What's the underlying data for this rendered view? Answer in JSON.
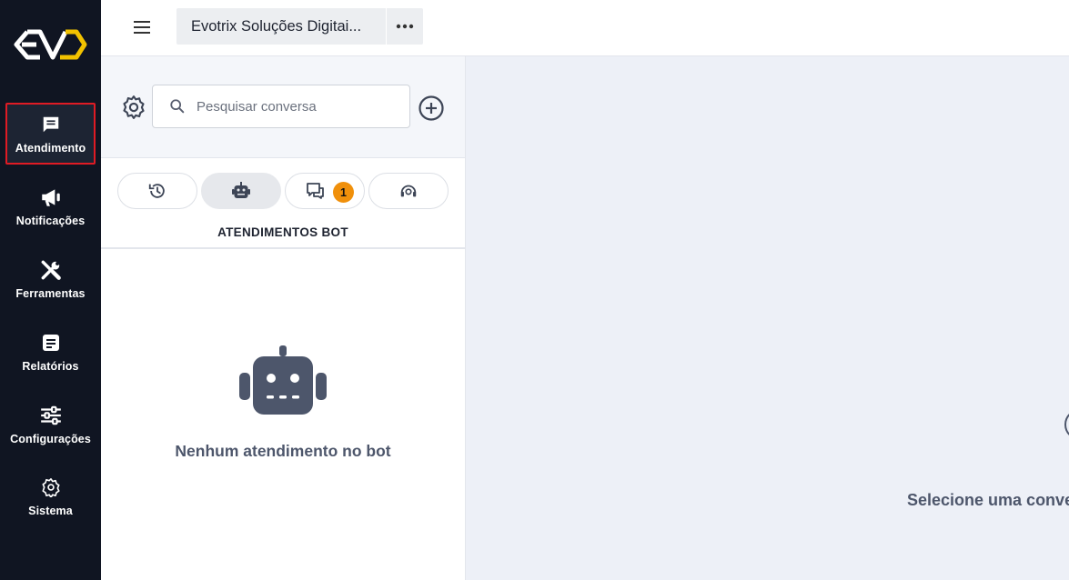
{
  "brand": {
    "logo_text": "EVO",
    "accent_color": "#f2c200"
  },
  "nav": {
    "items": [
      {
        "label": "Atendimento",
        "icon": "chat-icon",
        "active": true
      },
      {
        "label": "Notificações",
        "icon": "megaphone-icon"
      },
      {
        "label": "Ferramentas",
        "icon": "tools-icon"
      },
      {
        "label": "Relatórios",
        "icon": "report-icon"
      },
      {
        "label": "Configurações",
        "icon": "sliders-icon"
      },
      {
        "label": "Sistema",
        "icon": "gear-icon"
      }
    ]
  },
  "topbar": {
    "menu_icon": "hamburger-icon",
    "tenant_name": "Evotrix Soluções Digitai...",
    "more_icon": "more-horizontal-icon"
  },
  "conversations": {
    "settings_icon": "gear-icon",
    "search": {
      "placeholder": "Pesquisar conversa",
      "value": ""
    },
    "add_icon": "plus-circle-icon",
    "tabs": [
      {
        "icon": "history-icon",
        "active": false
      },
      {
        "icon": "robot-icon",
        "active": true
      },
      {
        "icon": "chat-bubbles-icon",
        "badge": "1",
        "active": false
      },
      {
        "icon": "support-agent-icon",
        "active": false
      }
    ],
    "section_title": "ATENDIMENTOS BOT",
    "empty_state": {
      "icon": "robot-icon",
      "text": "Nenhum atendimento no bot"
    }
  },
  "main": {
    "empty_text": "Selecione uma conversa"
  },
  "colors": {
    "nav_bg": "#101522",
    "badge": "#f0900b",
    "active_border": "#e01b24"
  }
}
